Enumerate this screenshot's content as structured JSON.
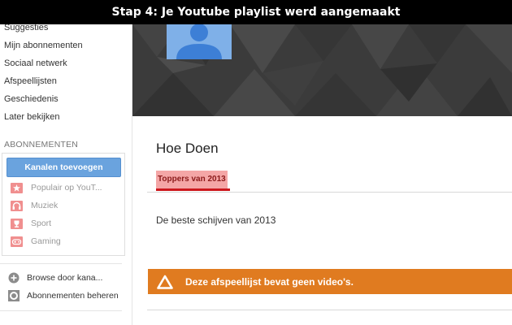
{
  "caption": "Stap 4: Je Youtube playlist werd aangemaakt",
  "sidebar": {
    "nav": [
      {
        "label": "Suggesties"
      },
      {
        "label": "Mijn abonnementen"
      },
      {
        "label": "Sociaal netwerk"
      },
      {
        "label": "Afspeellijsten"
      },
      {
        "label": "Geschiedenis"
      },
      {
        "label": "Later bekijken"
      }
    ],
    "section_heading": "ABONNEMENTEN",
    "add_channels_label": "Kanalen toevoegen",
    "subscriptions": [
      {
        "label": "Populair op YouT...",
        "icon": "star-icon"
      },
      {
        "label": "Muziek",
        "icon": "headphones-icon"
      },
      {
        "label": "Sport",
        "icon": "trophy-icon"
      },
      {
        "label": "Gaming",
        "icon": "gamepad-icon"
      }
    ],
    "footer": [
      {
        "label": "Browse door kana...",
        "icon": "plus-circle-icon"
      },
      {
        "label": "Abonnementen beheren",
        "icon": "gear-icon"
      }
    ]
  },
  "channel": {
    "name": "Hoe Doen",
    "tab_label": "Toppers van 2013",
    "playlist_description": "De beste schijven van 2013",
    "empty_notice": "Deze afspeellijst bevat geen video's."
  },
  "colors": {
    "accent_red": "#cc181e",
    "button_blue": "#6aa3de",
    "alert_orange": "#e07b20",
    "banner_dark": "#3a3a3a"
  }
}
